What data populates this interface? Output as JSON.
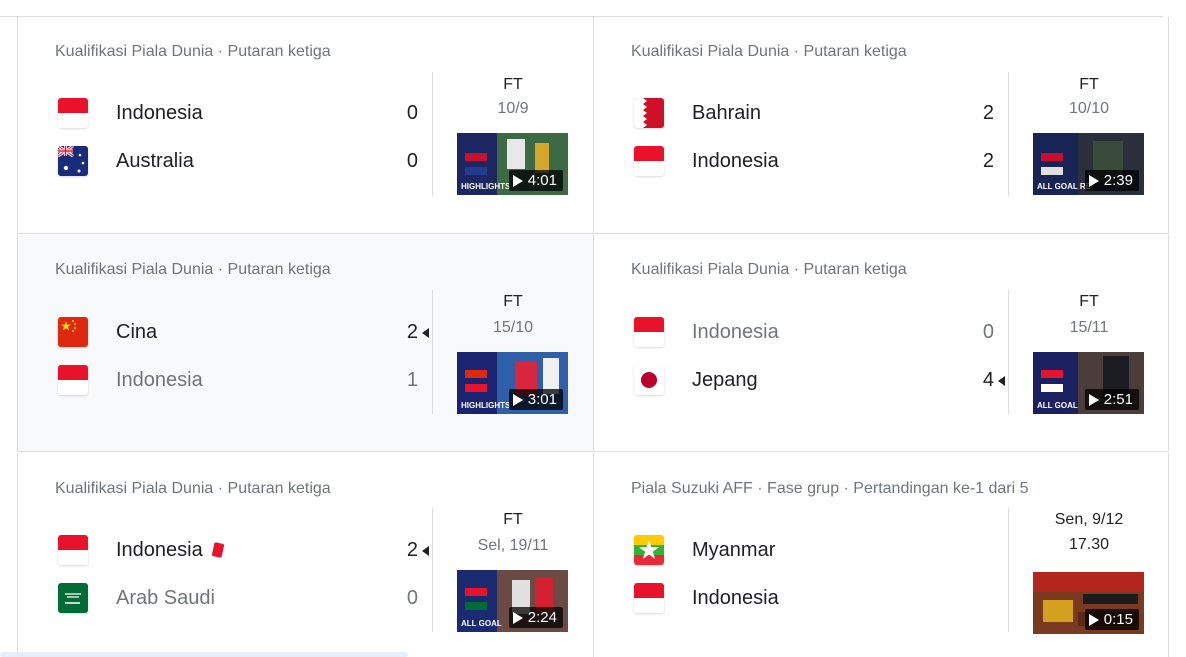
{
  "matches": [
    {
      "competition": "Kualifikasi Piala Dunia · Putaran ketiga",
      "home": {
        "name": "Indonesia",
        "score": "0",
        "flag": "indonesia-flag"
      },
      "away": {
        "name": "Australia",
        "score": "0",
        "flag": "australia-flag"
      },
      "status": "FT",
      "date": "10/9",
      "video": {
        "duration": "4:01",
        "caption": "HIGHLIGHTS"
      }
    },
    {
      "competition": "Kualifikasi Piala Dunia · Putaran ketiga",
      "home": {
        "name": "Bahrain",
        "score": "2",
        "flag": "bahrain-flag"
      },
      "away": {
        "name": "Indonesia",
        "score": "2",
        "flag": "indonesia-flag"
      },
      "status": "FT",
      "date": "10/10",
      "video": {
        "duration": "2:39",
        "caption": "ALL GOAL RE"
      }
    },
    {
      "competition": "Kualifikasi Piala Dunia · Putaran ketiga",
      "home": {
        "name": "Cina",
        "score": "2",
        "flag": "china-flag"
      },
      "away": {
        "name": "Indonesia",
        "score": "1",
        "flag": "indonesia-flag"
      },
      "status": "FT",
      "date": "15/10",
      "video": {
        "duration": "3:01",
        "caption": "HIGHLIGHTS"
      }
    },
    {
      "competition": "Kualifikasi Piala Dunia · Putaran ketiga",
      "home": {
        "name": "Indonesia",
        "score": "0",
        "flag": "indonesia-flag"
      },
      "away": {
        "name": "Jepang",
        "score": "4",
        "flag": "japan-flag"
      },
      "status": "FT",
      "date": "15/11",
      "video": {
        "duration": "2:51",
        "caption": "ALL GOAL"
      }
    },
    {
      "competition": "Kualifikasi Piala Dunia · Putaran ketiga",
      "home": {
        "name": "Indonesia",
        "score": "2",
        "flag": "indonesia-flag"
      },
      "away": {
        "name": "Arab Saudi",
        "score": "0",
        "flag": "saudi-flag"
      },
      "status": "FT",
      "date": "Sel, 19/11",
      "video": {
        "duration": "2:24",
        "caption": "ALL GOAL"
      }
    },
    {
      "competition": "Piala Suzuki AFF · Fase grup · Pertandingan ke-1 dari 5",
      "home": {
        "name": "Myanmar",
        "score": "",
        "flag": "myanmar-flag"
      },
      "away": {
        "name": "Indonesia",
        "score": "",
        "flag": "indonesia-flag"
      },
      "status": "Sen, 9/12",
      "date": "17.30",
      "video": {
        "duration": "0:15",
        "caption": ""
      }
    }
  ],
  "colors": {
    "border": "#dadce0",
    "muted": "#70757a",
    "text": "#202124",
    "highlight_bg": "#f8f9fa"
  }
}
